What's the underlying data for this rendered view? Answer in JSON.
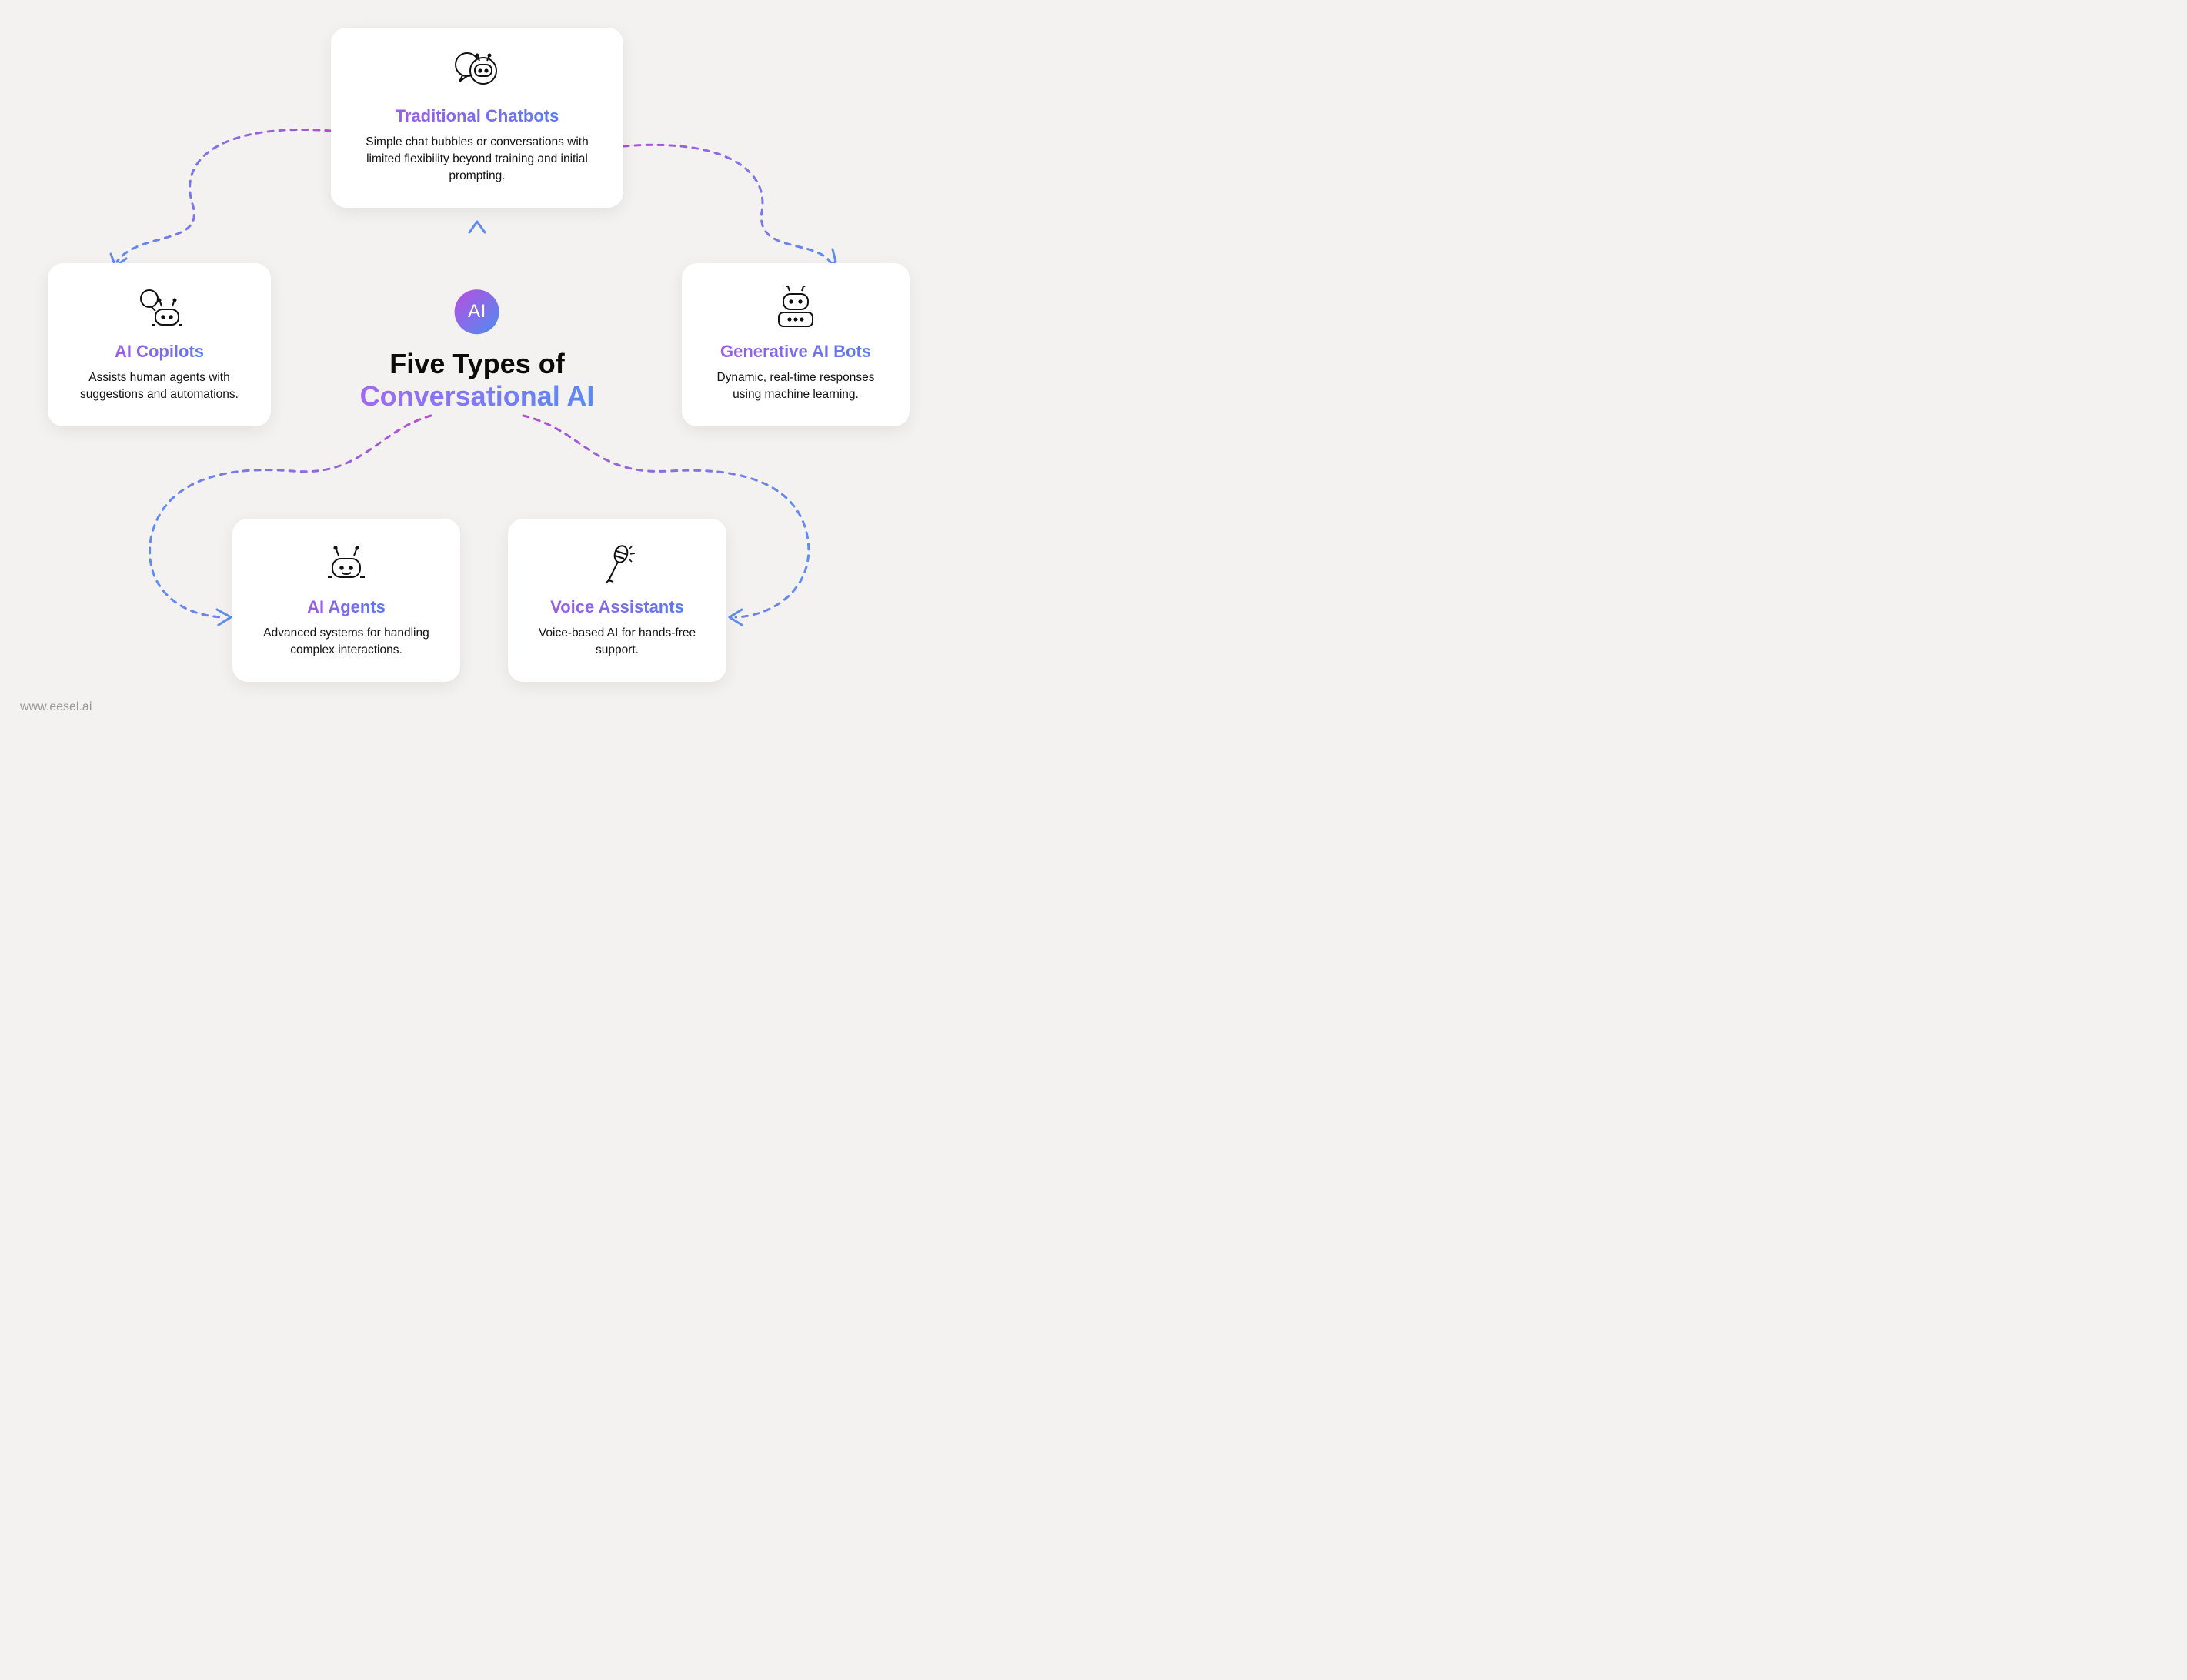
{
  "center": {
    "badge": "AI",
    "title_line1": "Five Types of",
    "title_line2": "Conversational AI"
  },
  "cards": {
    "top": {
      "title": "Traditional Chatbots",
      "desc": "Simple chat bubbles or conversations with limited flexibility beyond training and initial prompting."
    },
    "left": {
      "title": "AI Copilots",
      "desc": "Assists human agents with suggestions and automations."
    },
    "right": {
      "title": "Generative AI Bots",
      "desc": "Dynamic, real-time responses using machine learning."
    },
    "bl": {
      "title": "AI Agents",
      "desc": "Advanced systems for handling complex interactions."
    },
    "br": {
      "title": "Voice Assistants",
      "desc": "Voice-based AI for hands-free support."
    }
  },
  "attribution": "www.eesel.ai"
}
